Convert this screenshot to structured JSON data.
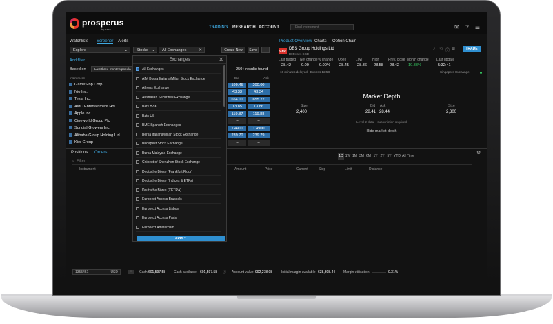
{
  "app": {
    "brand": "prosperus",
    "brand_sub": "by saxo"
  },
  "nav": {
    "trading": "TRADING",
    "research": "RESEARCH",
    "account": "ACCOUNT",
    "search_placeholder": "Find instrument"
  },
  "left_tabs": {
    "watchlists": "Watchlists",
    "screener": "Screener",
    "alerts": "Alerts"
  },
  "screener": {
    "explore": "Explore",
    "asset": "Stocks",
    "exchange": "All Exchanges",
    "create_new": "Create New",
    "save": "Save",
    "more": "···",
    "add_filter": "Add filter",
    "based_on": "Based on",
    "based_value": "Last three month's popula",
    "results": "250+ results found",
    "col_instrument": "Instrument",
    "col_bid": "Bid",
    "col_ask": "Ask",
    "rows": [
      {
        "name": "GameStop Corp.",
        "bid": "199.45",
        "ask": "200.00"
      },
      {
        "name": "Nio Inc.",
        "bid": "43.33",
        "ask": "43.34"
      },
      {
        "name": "Tesla Inc.",
        "bid": "654.00",
        "ask": "655.22"
      },
      {
        "name": "AMC Entertainment Hol…",
        "bid": "13.85",
        "ask": "13.86"
      },
      {
        "name": "Apple Inc.",
        "bid": "119.87",
        "ask": "119.88"
      },
      {
        "name": "Cineworld Group Plc",
        "bid": "–",
        "ask": "–"
      },
      {
        "name": "Sundial Growers Inc.",
        "bid": "1.4900",
        "ask": "1.4900"
      },
      {
        "name": "Alibaba Group Holding Ltd",
        "bid": "239.70",
        "ask": "239.79"
      },
      {
        "name": "Kier Group",
        "bid": "–",
        "ask": "–"
      }
    ]
  },
  "exchanges": {
    "title": "Exchanges",
    "apply": "APPLY",
    "options": [
      "All Exchanges",
      "AIM Borsa Italiana/Milan Stock Exchange",
      "Athens Exchange",
      "Australian Securities Exchange",
      "Bats BZX",
      "Bats US",
      "BME Spanish Exchanges",
      "Borsa Italiana/Milan Stock Exchange",
      "Budapest Stock Exchange",
      "Bursa Malaysia Exchange",
      "Chinext of Shenzhen Stock Exchange",
      "Deutsche Börse (Frankfurt Floor)",
      "Deutsche Börse (Indices & ETFs)",
      "Deutsche Börse (XETRA)",
      "Euronext Access Brussels",
      "Euronext Access Lisbon",
      "Euronext Access Paris",
      "Euronext Amsterdam"
    ]
  },
  "product": {
    "tabs": [
      "Product Overview",
      "Charts",
      "Option Chain"
    ],
    "badge": "CFD",
    "name": "DBS Group Holdings Ltd",
    "sub": "D05:xsès SGD",
    "trade": "TRADE",
    "quote_headers": [
      "Last traded",
      "Net change",
      "% change",
      "Open",
      "Low",
      "High",
      "Prev. close",
      "Month change",
      "Last update"
    ],
    "quote_values": [
      "28.42",
      "0.00",
      "0.00%",
      "28.45",
      "28.36",
      "28.58",
      "28.42",
      "10.33%",
      "5:32:41"
    ],
    "delay": "10 minutes delayed - Expires 12:58",
    "exchange": "Singapore Exchange",
    "md_title": "Market Depth",
    "size": "Size",
    "bid": "Bid",
    "ask": "Ask",
    "bid_size": "2,400",
    "bid_price": "28.41",
    "ask_price": "28.44",
    "ask_size": "2,300",
    "level2": "Level 2 data – subscription required",
    "hide": "Hide market depth",
    "timeframes": [
      "1D",
      "1W",
      "1M",
      "3M",
      "6M",
      "1Y",
      "2Y",
      "5Y",
      "YTD",
      "All Time"
    ]
  },
  "bottom": {
    "tabs": [
      "Positions",
      "Orders"
    ],
    "filter": "Filter",
    "cols": [
      "Instrument",
      "Amount",
      "Price",
      "Current",
      "Step",
      "Limit",
      "Distance"
    ]
  },
  "footer": {
    "account": "1355451",
    "currency": "USD",
    "cash_label": "Cash:",
    "cash": "601,597.58",
    "cash_avail_label": "Cash available:",
    "cash_avail": "601,597.58",
    "account_value_label": "Account value:",
    "account_value": "992,278.08",
    "initial_margin_label": "Initial margin available:",
    "initial_margin": "638,308.44",
    "margin_util_label": "Margin utilisation:",
    "margin_util": "0.31%"
  },
  "colors": {
    "accent": "#3fa9e0",
    "bid": "#2d6ea8",
    "ask": "#c0392b",
    "positive": "#35c45f"
  }
}
